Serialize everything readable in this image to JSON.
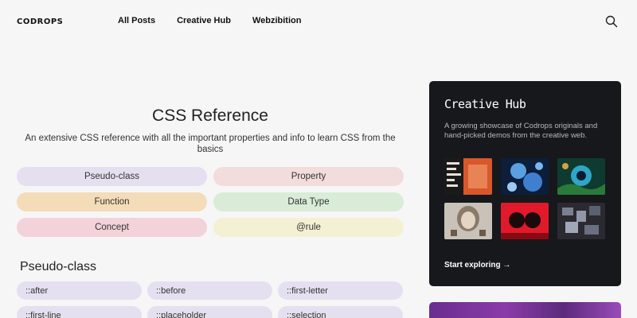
{
  "header": {
    "logo": "CODROPS",
    "nav": [
      "All Posts",
      "Creative Hub",
      "Webzibition"
    ]
  },
  "hero": {
    "title": "CSS Reference",
    "subtitle": "An extensive CSS reference with all the important properties and info to learn CSS from the basics"
  },
  "categories": [
    {
      "label": "Pseudo-class",
      "color": "#e4e0ef"
    },
    {
      "label": "Property",
      "color": "#f3dcdc"
    },
    {
      "label": "Function",
      "color": "#f4dcb8"
    },
    {
      "label": "Data Type",
      "color": "#d8ecd8"
    },
    {
      "label": "Concept",
      "color": "#f3d2da"
    },
    {
      "label": "@rule",
      "color": "#f4f0d4"
    }
  ],
  "section": {
    "title": "Pseudo-class",
    "items": [
      "::after",
      "::before",
      "::first-letter",
      "::first-line",
      "::placeholder",
      "::selection"
    ]
  },
  "creative_hub": {
    "title": "Creative Hub",
    "description": "A growing showcase of Codrops originals and hand-picked demos from the creative web.",
    "link": "Start exploring →"
  }
}
